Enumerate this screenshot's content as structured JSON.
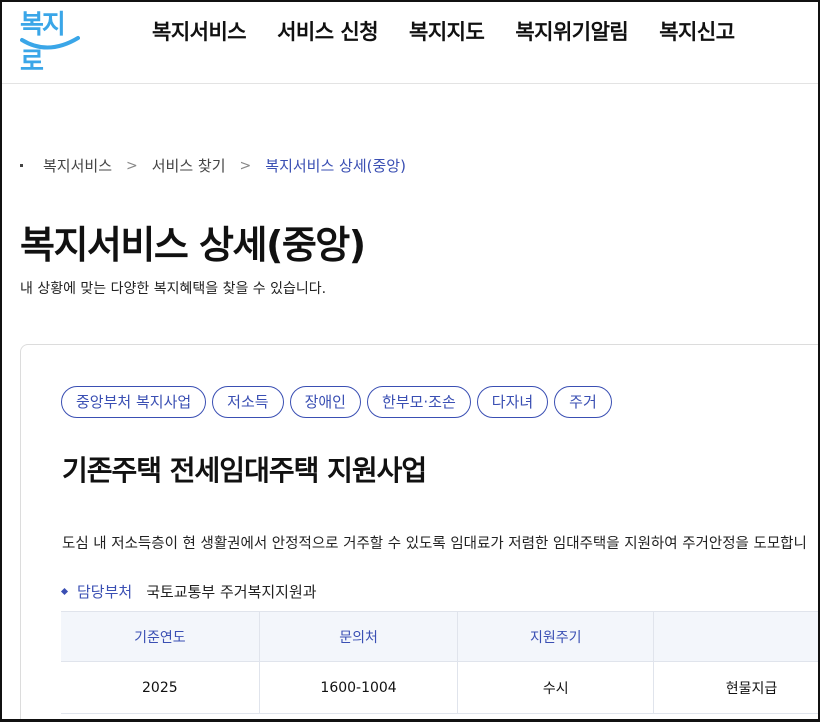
{
  "logo": {
    "text": "복지로",
    "color": "#3aa6e8"
  },
  "gnb": {
    "items": [
      {
        "label": "복지서비스"
      },
      {
        "label": "서비스 신청"
      },
      {
        "label": "복지지도"
      },
      {
        "label": "복지위기알림"
      },
      {
        "label": "복지신고"
      }
    ]
  },
  "breadcrumb": {
    "items": [
      "복지서비스",
      "서비스 찾기"
    ],
    "current": "복지서비스 상세(중앙)",
    "separator": ">"
  },
  "page": {
    "title": "복지서비스 상세(중앙)",
    "description": "내 상황에 맞는 다양한 복지혜택을 찾을 수 있습니다."
  },
  "service": {
    "tags": [
      "중앙부처 복지사업",
      "저소득",
      "장애인",
      "한부모·조손",
      "다자녀",
      "주거"
    ],
    "title": "기존주택 전세임대주택 지원사업",
    "description": "도심 내 저소득층이 현 생활권에서 안정적으로 거주할 수 있도록 임대료가 저렴한 임대주택을 지원하여 주거안정을 도모합니",
    "dept_label": "담당부처",
    "dept_value": "국토교통부 주거복지지원과",
    "table": {
      "headers": [
        "기준연도",
        "문의처",
        "지원주기",
        ""
      ],
      "row": [
        "2025",
        "1600-1004",
        "수시",
        "현물지급"
      ]
    }
  },
  "colors": {
    "accent": "#3a4fb3",
    "table_header_bg": "#f3f6fb"
  }
}
